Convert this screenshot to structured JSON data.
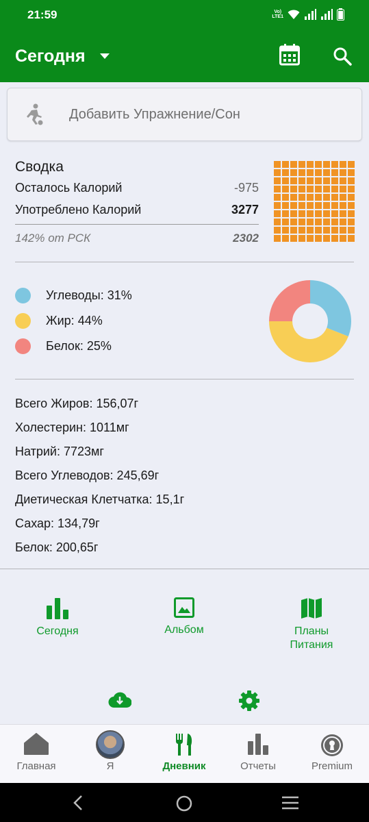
{
  "status": {
    "time": "21:59",
    "volte": "Vo) LTE1"
  },
  "appbar": {
    "title": "Сегодня"
  },
  "exercise": {
    "label": "Добавить Упражнение/Сон"
  },
  "summary": {
    "title": "Сводка",
    "remaining_label": "Осталось Калорий",
    "remaining_value": "-975",
    "consumed_label": "Употреблено Калорий",
    "consumed_value": "3277",
    "rsk_label": "142% от РСК",
    "rsk_value": "2302"
  },
  "macros": [
    {
      "label": "Углеводы: 31%",
      "color": "#7ec6e0",
      "percent": 31
    },
    {
      "label": "Жир: 44%",
      "color": "#f8ce55",
      "percent": 44
    },
    {
      "label": "Белок: 25%",
      "color": "#f2857f",
      "percent": 25
    }
  ],
  "nutrients": [
    "Всего Жиров: 156,07г",
    "Холестерин: 1011мг",
    "Натрий: 7723мг",
    "Всего Углеводов: 245,69г",
    "Диетическая Клетчатка: 15,1г",
    "Сахар: 134,79г",
    "Белок: 200,65г"
  ],
  "tiles": [
    {
      "label": "Сегодня",
      "icon": "bar-chart-icon"
    },
    {
      "label": "Альбом",
      "icon": "image-icon"
    },
    {
      "label": "Планы Питания",
      "icon": "map-icon"
    }
  ],
  "nav": {
    "home": "Главная",
    "me": "Я",
    "diary": "Дневник",
    "reports": "Отчеты",
    "premium": "Premium"
  },
  "colors": {
    "brand": "#0a8a1a",
    "accent_green": "#0f9a2b",
    "waffle": "#f09324"
  }
}
